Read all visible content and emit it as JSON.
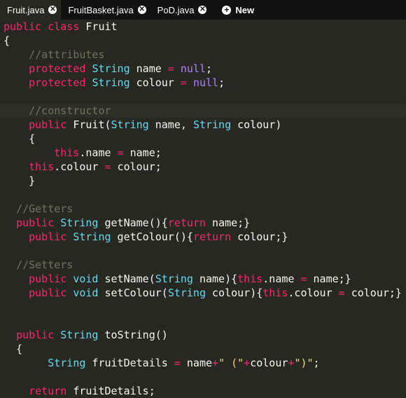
{
  "tabs": [
    {
      "label": "Fruit.java",
      "active": true
    },
    {
      "label": "FruitBasket.java",
      "active": false
    },
    {
      "label": "PoD.java",
      "active": false
    }
  ],
  "new_tab_label": "New",
  "code_lines": [
    [
      [
        "kw",
        "public"
      ],
      [
        "t",
        " "
      ],
      [
        "kw",
        "class"
      ],
      [
        "t",
        " Fruit"
      ]
    ],
    [
      [
        "t",
        "{"
      ]
    ],
    [
      [
        "t",
        "    "
      ],
      [
        "cm",
        "//attributes"
      ]
    ],
    [
      [
        "t",
        "    "
      ],
      [
        "kw",
        "protected"
      ],
      [
        "t",
        " "
      ],
      [
        "type",
        "String"
      ],
      [
        "t",
        " name "
      ],
      [
        "kw",
        "="
      ],
      [
        "t",
        " "
      ],
      [
        "num",
        "null"
      ],
      [
        "t",
        ";"
      ]
    ],
    [
      [
        "t",
        "    "
      ],
      [
        "kw",
        "protected"
      ],
      [
        "t",
        " "
      ],
      [
        "type",
        "String"
      ],
      [
        "t",
        " colour "
      ],
      [
        "kw",
        "="
      ],
      [
        "t",
        " "
      ],
      [
        "num",
        "null"
      ],
      [
        "t",
        ";"
      ]
    ],
    [
      [
        "t",
        ""
      ]
    ],
    [
      [
        "t",
        "    "
      ],
      [
        "cm",
        "//constructor"
      ]
    ],
    [
      [
        "t",
        "    "
      ],
      [
        "kw",
        "public"
      ],
      [
        "t",
        " Fruit("
      ],
      [
        "type",
        "String"
      ],
      [
        "t",
        " name, "
      ],
      [
        "type",
        "String"
      ],
      [
        "t",
        " colour)"
      ]
    ],
    [
      [
        "t",
        "    {"
      ]
    ],
    [
      [
        "t",
        "        "
      ],
      [
        "kw",
        "this"
      ],
      [
        "t",
        ".name "
      ],
      [
        "kw",
        "="
      ],
      [
        "t",
        " name;"
      ]
    ],
    [
      [
        "t",
        "    "
      ],
      [
        "kw",
        "this"
      ],
      [
        "t",
        ".colour "
      ],
      [
        "kw",
        "="
      ],
      [
        "t",
        " colour;"
      ]
    ],
    [
      [
        "t",
        "    }"
      ]
    ],
    [
      [
        "t",
        ""
      ]
    ],
    [
      [
        "t",
        "  "
      ],
      [
        "cm",
        "//Getters"
      ]
    ],
    [
      [
        "t",
        "  "
      ],
      [
        "kw",
        "public"
      ],
      [
        "t",
        " "
      ],
      [
        "type",
        "String"
      ],
      [
        "t",
        " getName(){"
      ],
      [
        "kw",
        "return"
      ],
      [
        "t",
        " name;}"
      ]
    ],
    [
      [
        "t",
        "    "
      ],
      [
        "kw",
        "public"
      ],
      [
        "t",
        " "
      ],
      [
        "type",
        "String"
      ],
      [
        "t",
        " getColour(){"
      ],
      [
        "kw",
        "return"
      ],
      [
        "t",
        " colour;}"
      ]
    ],
    [
      [
        "t",
        ""
      ]
    ],
    [
      [
        "t",
        "  "
      ],
      [
        "cm",
        "//Setters"
      ]
    ],
    [
      [
        "t",
        "    "
      ],
      [
        "kw",
        "public"
      ],
      [
        "t",
        " "
      ],
      [
        "type",
        "void"
      ],
      [
        "t",
        " setName("
      ],
      [
        "type",
        "String"
      ],
      [
        "t",
        " name){"
      ],
      [
        "kw",
        "this"
      ],
      [
        "t",
        ".name "
      ],
      [
        "kw",
        "="
      ],
      [
        "t",
        " name;}"
      ]
    ],
    [
      [
        "t",
        "    "
      ],
      [
        "kw",
        "public"
      ],
      [
        "t",
        " "
      ],
      [
        "type",
        "void"
      ],
      [
        "t",
        " setColour("
      ],
      [
        "type",
        "String"
      ],
      [
        "t",
        " colour){"
      ],
      [
        "kw",
        "this"
      ],
      [
        "t",
        ".colour "
      ],
      [
        "kw",
        "="
      ],
      [
        "t",
        " colour;}"
      ]
    ],
    [
      [
        "t",
        ""
      ]
    ],
    [
      [
        "t",
        ""
      ]
    ],
    [
      [
        "t",
        "  "
      ],
      [
        "kw",
        "public"
      ],
      [
        "t",
        " "
      ],
      [
        "type",
        "String"
      ],
      [
        "t",
        " toString()"
      ]
    ],
    [
      [
        "t",
        "  {"
      ]
    ],
    [
      [
        "t",
        "       "
      ],
      [
        "type",
        "String"
      ],
      [
        "t",
        " fruitDetails "
      ],
      [
        "kw",
        "="
      ],
      [
        "t",
        " name"
      ],
      [
        "kw",
        "+"
      ],
      [
        "str",
        "\" (\""
      ],
      [
        "kw",
        "+"
      ],
      [
        "t",
        "colour"
      ],
      [
        "kw",
        "+"
      ],
      [
        "str",
        "\")\""
      ],
      [
        "t",
        ";"
      ]
    ],
    [
      [
        "t",
        ""
      ]
    ],
    [
      [
        "t",
        "    "
      ],
      [
        "kw",
        "return"
      ],
      [
        "t",
        " fruitDetails;"
      ]
    ]
  ],
  "current_line_index": 6
}
